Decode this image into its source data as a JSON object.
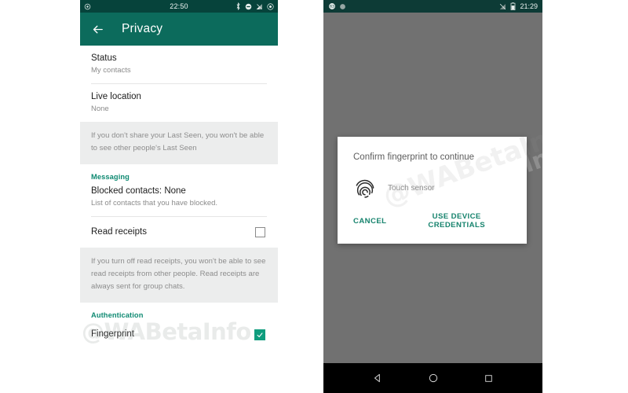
{
  "left_phone": {
    "status_bar": {
      "clock": "22:50",
      "icons_left": [
        "alarm-icon"
      ],
      "icons_right": [
        "bluetooth-icon",
        "do-not-disturb-icon",
        "signal-icon",
        "battery-icon"
      ]
    },
    "toolbar": {
      "back_label": "Back",
      "title": "Privacy"
    },
    "rows": [
      {
        "title": "Status",
        "subtitle": "My contacts"
      },
      {
        "title": "Live location",
        "subtitle": "None"
      }
    ],
    "last_seen_note": "If you don't share your Last Seen, you won't be able to see other people's Last Seen",
    "messaging_header": "Messaging",
    "blocked": {
      "title": "Blocked contacts: None",
      "subtitle": "List of contacts that you have blocked."
    },
    "read_receipts": {
      "label": "Read receipts",
      "checked": false
    },
    "read_receipts_note": "If you turn off read receipts, you won't be able to see read receipts from other people. Read receipts are always sent for group chats.",
    "authentication_header": "Authentication",
    "fingerprint": {
      "label": "Fingerprint",
      "checked": true
    },
    "watermark": "@WABetaInfo"
  },
  "right_phone": {
    "status_bar": {
      "clock": "21:29",
      "icons_left": [
        "app-badge-icon",
        "circle-icon"
      ],
      "icons_right": [
        "no-signal-icon",
        "battery-icon"
      ]
    },
    "dialog": {
      "title": "Confirm fingerprint to continue",
      "sensor_text": "Touch sensor",
      "fingerprint_icon": "fingerprint-icon",
      "cancel_label": "CANCEL",
      "credentials_label": "USE DEVICE CREDENTIALS"
    },
    "watermark": "@WABetaInfo",
    "nav_bar": {
      "back": "back-triangle-icon",
      "home": "home-circle-icon",
      "recents": "recents-square-icon"
    }
  },
  "colors": {
    "whatsapp_teal": "#0c6b5c",
    "status_bar_dark": "#06433b",
    "accent_green": "#0f8a72",
    "checkbox_green": "#0f9d7e",
    "dialog_action": "#16836d",
    "scrim_gray": "#717171"
  }
}
